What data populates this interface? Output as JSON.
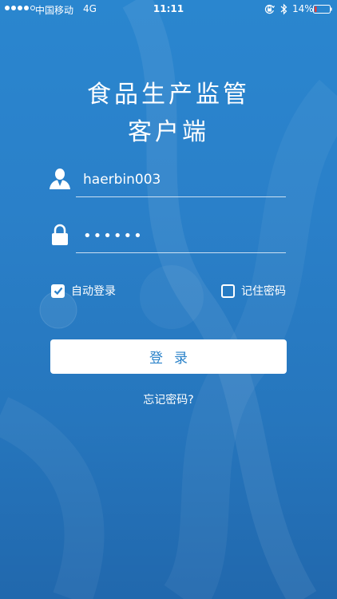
{
  "status_bar": {
    "carrier": "中国移动",
    "network": "4G",
    "time": "11:11",
    "battery_percent": "14%",
    "battery_level": 0.14,
    "signal_bars_filled": 4,
    "signal_bars_total": 5,
    "icons": [
      "orientation-lock-icon",
      "bluetooth-icon",
      "battery-icon"
    ]
  },
  "header": {
    "title_line1": "食品生产监管",
    "title_line2": "客户端"
  },
  "login_form": {
    "username": {
      "value": "haerbin003",
      "icon": "user-icon"
    },
    "password": {
      "value": "••••••",
      "icon": "lock-icon"
    },
    "auto_login": {
      "label": "自动登录",
      "checked": true
    },
    "remember_password": {
      "label": "记住密码",
      "checked": false
    },
    "login_button_label": "登录",
    "forgot_password_label": "忘记密码?"
  },
  "colors": {
    "background_top": "#2a86cf",
    "background_bottom": "#2168ad",
    "button_background": "#ffffff",
    "button_text": "#2a82c9",
    "battery_low": "#e53935"
  }
}
